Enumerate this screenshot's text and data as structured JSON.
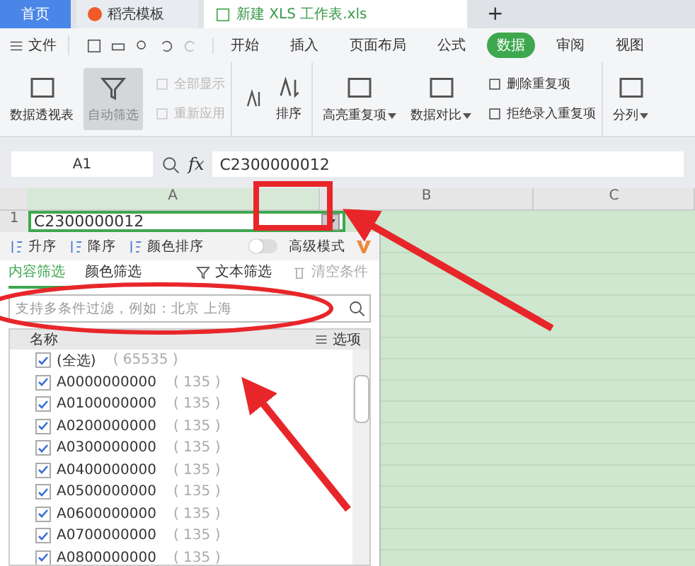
{
  "doc_tabs": [
    {
      "label": "首页",
      "kind": "home",
      "selected": false
    },
    {
      "label": "稻壳模板",
      "kind": "template",
      "selected": false
    },
    {
      "label": "新建 XLS 工作表.xls",
      "kind": "sheet",
      "selected": true
    }
  ],
  "new_tab": "+",
  "file_menu": "文件",
  "menu_tabs": [
    {
      "label": "开始",
      "selected": false
    },
    {
      "label": "插入",
      "selected": false
    },
    {
      "label": "页面布局",
      "selected": false
    },
    {
      "label": "公式",
      "selected": false
    },
    {
      "label": "数据",
      "selected": true
    },
    {
      "label": "审阅",
      "selected": false
    },
    {
      "label": "视图",
      "selected": false
    }
  ],
  "ribbon": [
    {
      "kind": "large",
      "label": "数据透视表",
      "selected": false,
      "dropdown": false
    },
    {
      "kind": "large",
      "label": "自动筛选",
      "selected": true,
      "dropdown": false
    },
    {
      "kind": "stack",
      "items": [
        {
          "label": "全部显示",
          "disabled": true
        },
        {
          "label": "重新应用",
          "disabled": true
        }
      ]
    },
    {
      "kind": "sort",
      "label": "排序"
    },
    {
      "kind": "large",
      "label": "高亮重复项",
      "selected": false,
      "dropdown": true
    },
    {
      "kind": "large",
      "label": "数据对比",
      "selected": false,
      "dropdown": true
    },
    {
      "kind": "stack",
      "items": [
        {
          "label": "删除重复项",
          "disabled": false
        },
        {
          "label": "拒绝录入重复项",
          "disabled": false
        }
      ]
    },
    {
      "kind": "large",
      "label": "分列",
      "selected": false,
      "dropdown": true
    }
  ],
  "name_box": "A1",
  "fx_label": "fx",
  "formula": "C2300000012",
  "columns": [
    "A",
    "B",
    "C"
  ],
  "row_number": "1",
  "cell_a1": "C2300000012",
  "filter_panel": {
    "sort_buttons": [
      "升序",
      "降序",
      "颜色排序"
    ],
    "advanced_mode": {
      "label": "高级模式",
      "on": false
    },
    "tabs": [
      {
        "label": "内容筛选",
        "selected": true,
        "kind": "tab"
      },
      {
        "label": "颜色筛选",
        "selected": false,
        "kind": "tab"
      },
      {
        "label": "文本筛选",
        "selected": false,
        "kind": "action"
      },
      {
        "label": "清空条件",
        "selected": false,
        "kind": "clear"
      }
    ],
    "search": {
      "placeholder": "支持多条件过滤，例如：北京 上海"
    },
    "list_header": "名称",
    "options_label": "选项",
    "items": [
      {
        "label": "(全选)",
        "count": "( 65535 )",
        "checked": true
      },
      {
        "label": "A0000000000",
        "count": "( 135 )",
        "checked": true
      },
      {
        "label": "A0100000000",
        "count": "( 135 )",
        "checked": true
      },
      {
        "label": "A0200000000",
        "count": "( 135 )",
        "checked": true
      },
      {
        "label": "A0300000000",
        "count": "( 135 )",
        "checked": true
      },
      {
        "label": "A0400000000",
        "count": "( 135 )",
        "checked": true
      },
      {
        "label": "A0500000000",
        "count": "( 135 )",
        "checked": true
      },
      {
        "label": "A0600000000",
        "count": "( 135 )",
        "checked": true
      },
      {
        "label": "A0700000000",
        "count": "( 135 )",
        "checked": true
      },
      {
        "label": "A0800000000",
        "count": "( 135 )",
        "checked": true
      }
    ]
  }
}
